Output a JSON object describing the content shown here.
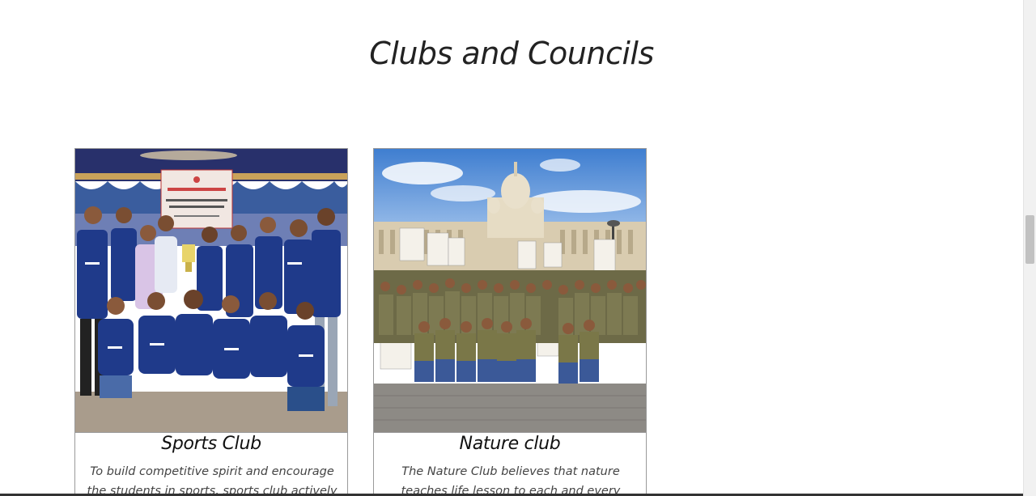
{
  "section": {
    "title": "Clubs and Councils"
  },
  "cards": [
    {
      "title": "Sports Club",
      "description": "To build competitive spirit and encourage the students in sports, sports club actively"
    },
    {
      "title": "Nature club",
      "description": "The Nature Club believes that nature teaches life lesson to each and every individual in its"
    }
  ],
  "colors": {
    "heading": "#222222",
    "card_border": "#9a9a9a",
    "body_text": "#444444",
    "jersey_blue": "#1f3a8a",
    "nature_shirt": "#6b6b3a",
    "sky": "#5b8fd6"
  }
}
